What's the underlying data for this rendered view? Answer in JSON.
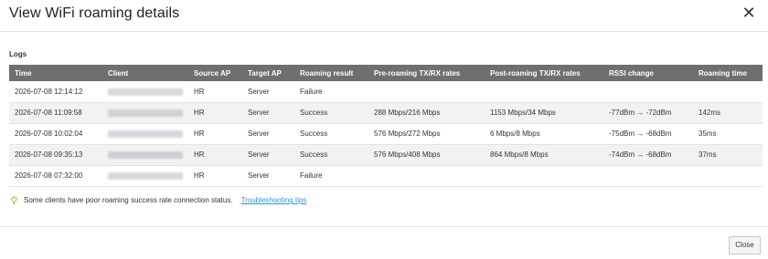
{
  "dialog": {
    "title": "View WiFi roaming details",
    "close_glyph": "✕",
    "close_icon": "close-icon"
  },
  "logs": {
    "label": "Logs",
    "columns": [
      "Time",
      "Client",
      "Source AP",
      "Target AP",
      "Roaming result",
      "Pre-roaming TX/RX rates",
      "Post-roaming TX/RX rates",
      "RSSI change",
      "Roaming time"
    ],
    "rows": [
      {
        "time": "2026-07-08 12:14:12",
        "client": "",
        "source_ap": "HR",
        "target_ap": "Server",
        "result": "Failure",
        "pre_rates": "",
        "post_rates": "",
        "rssi": "",
        "roaming_time": ""
      },
      {
        "time": "2026-07-08 11:09:58",
        "client": "",
        "source_ap": "HR",
        "target_ap": "Server",
        "result": "Success",
        "pre_rates": "288 Mbps/216 Mbps",
        "post_rates": "1153 Mbps/34 Mbps",
        "rssi": "-77dBm → -72dBm",
        "roaming_time": "142ms"
      },
      {
        "time": "2026-07-08 10:02:04",
        "client": "",
        "source_ap": "HR",
        "target_ap": "Server",
        "result": "Success",
        "pre_rates": "576 Mbps/272 Mbps",
        "post_rates": "6 Mbps/8 Mbps",
        "rssi": "-75dBm → -68dBm",
        "roaming_time": "35ms"
      },
      {
        "time": "2026-07-08 09:35:13",
        "client": "",
        "source_ap": "HR",
        "target_ap": "Server",
        "result": "Success",
        "pre_rates": "576 Mbps/408 Mbps",
        "post_rates": "864 Mbps/8 Mbps",
        "rssi": "-74dBm → -68dBm",
        "roaming_time": "37ms"
      },
      {
        "time": "2026-07-08 07:32:00",
        "client": "",
        "source_ap": "HR",
        "target_ap": "Server",
        "result": "Failure",
        "pre_rates": "",
        "post_rates": "",
        "rssi": "",
        "roaming_time": ""
      }
    ]
  },
  "hint": {
    "icon": "lightbulb-icon",
    "icon_color": "#8bc34a",
    "text": "Some clients have poor roaming success rate connection status.",
    "link_text": "Troubleshooting tips",
    "link_color": "#1a9bd7"
  },
  "footer": {
    "close_label": "Close"
  }
}
